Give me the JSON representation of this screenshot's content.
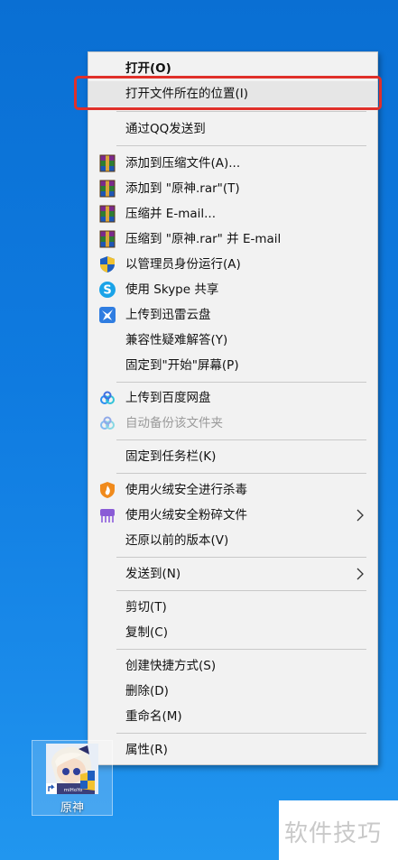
{
  "menu": {
    "open": "打开(O)",
    "open_location": "打开文件所在的位置(I)",
    "send_qq": "通过QQ发送到",
    "add_archive": "添加到压缩文件(A)...",
    "add_rar": "添加到 \"原神.rar\"(T)",
    "compress_email": "压缩并 E-mail...",
    "compress_rar_email": "压缩到 \"原神.rar\" 并 E-mail",
    "run_as_admin": "以管理员身份运行(A)",
    "skype_share": "使用 Skype 共享",
    "xunlei_upload": "上传到迅雷云盘",
    "compat": "兼容性疑难解答(Y)",
    "pin_start": "固定到\"开始\"屏幕(P)",
    "baidu_upload": "上传到百度网盘",
    "baidu_backup": "自动备份该文件夹",
    "pin_taskbar": "固定到任务栏(K)",
    "huorong_scan": "使用火绒安全进行杀毒",
    "huorong_shred": "使用火绒安全粉碎文件",
    "restore_prev": "还原以前的版本(V)",
    "send_to": "发送到(N)",
    "cut": "剪切(T)",
    "copy": "复制(C)",
    "create_shortcut": "创建快捷方式(S)",
    "delete": "删除(D)",
    "rename": "重命名(M)",
    "properties": "属性(R)"
  },
  "desktop": {
    "icon_label": "原神",
    "icon_badge": "miHoYo"
  },
  "watermark": "软件技巧",
  "colors": {
    "highlight_border": "#e0302a",
    "menu_bg": "#f2f2f2",
    "desktop_bg": "#0f7be0"
  },
  "icons": {
    "winrar": "winrar-icon",
    "shield": "uac-shield-icon",
    "skype": "skype-icon",
    "xunlei": "xunlei-icon",
    "baidu": "baidu-netdisk-icon",
    "huorong": "huorong-icon",
    "shredder": "shredder-icon",
    "submenu": "chevron-right-icon"
  }
}
